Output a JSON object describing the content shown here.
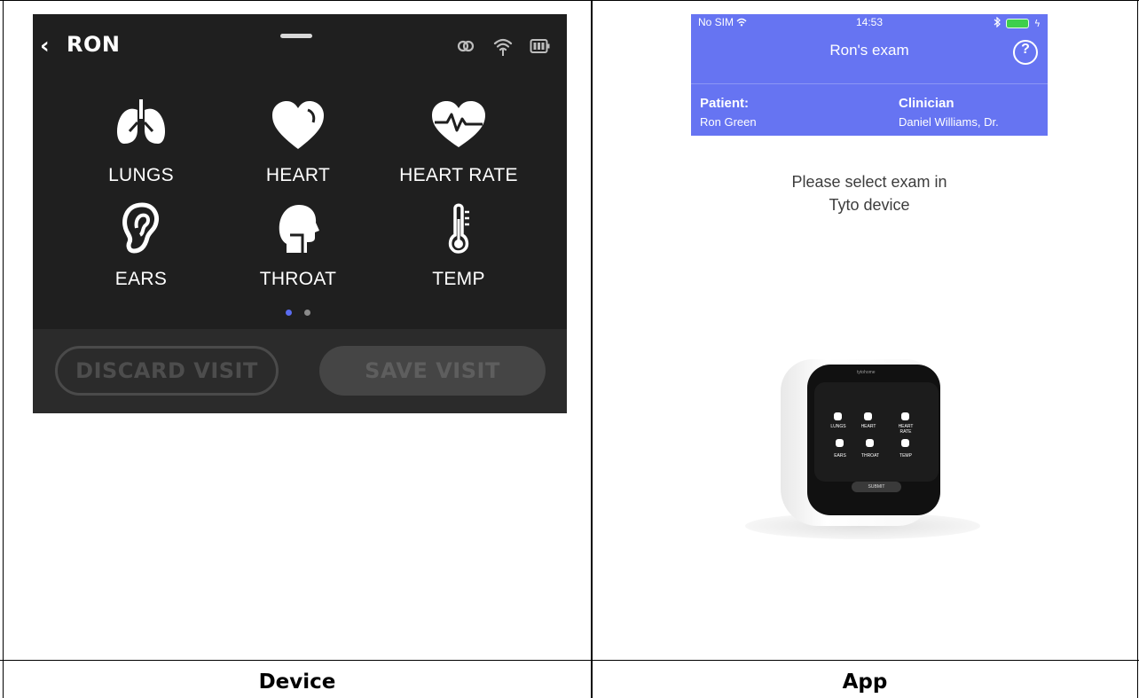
{
  "device": {
    "back_icon": "chevron-left-icon",
    "patient_name": "RON",
    "status_icons": [
      "link-icon",
      "wifi-icon",
      "battery-icon"
    ],
    "tiles": [
      {
        "label": "LUNGS",
        "icon": "lungs-icon"
      },
      {
        "label": "HEART",
        "icon": "heart-icon"
      },
      {
        "label": "HEART RATE",
        "icon": "heart-rate-icon"
      },
      {
        "label": "EARS",
        "icon": "ear-icon"
      },
      {
        "label": "THROAT",
        "icon": "throat-icon"
      },
      {
        "label": "TEMP",
        "icon": "thermometer-icon"
      }
    ],
    "pager": {
      "count": 2,
      "active": 1,
      "active_color": "#5a6cf0",
      "inactive_color": "#8a8a8a"
    },
    "discard_label": "DISCARD VISIT",
    "save_label": "SAVE VISIT"
  },
  "app": {
    "status_bar": {
      "carrier": "No SIM",
      "time": "14:53",
      "bluetooth_icon": "bluetooth-icon",
      "battery_icon": "battery-icon",
      "battery_color": "#3ecf4c"
    },
    "title": "Ron's exam",
    "help_label": "?",
    "patient_label": "Patient:",
    "patient_value": "Ron Green",
    "clinician_label": "Clinician",
    "clinician_value": "Daniel Williams, Dr.",
    "header_color": "#6674f2",
    "message_line1": "Please select exam in",
    "message_line2": "Tyto device",
    "device_image": {
      "brand": "tytohome",
      "tiles": [
        "LUNGS",
        "HEART",
        "HEART RATE",
        "EARS",
        "THROAT",
        "TEMP"
      ],
      "button": "SUBMIT"
    }
  },
  "captions": {
    "left": "Device",
    "right": "App"
  }
}
